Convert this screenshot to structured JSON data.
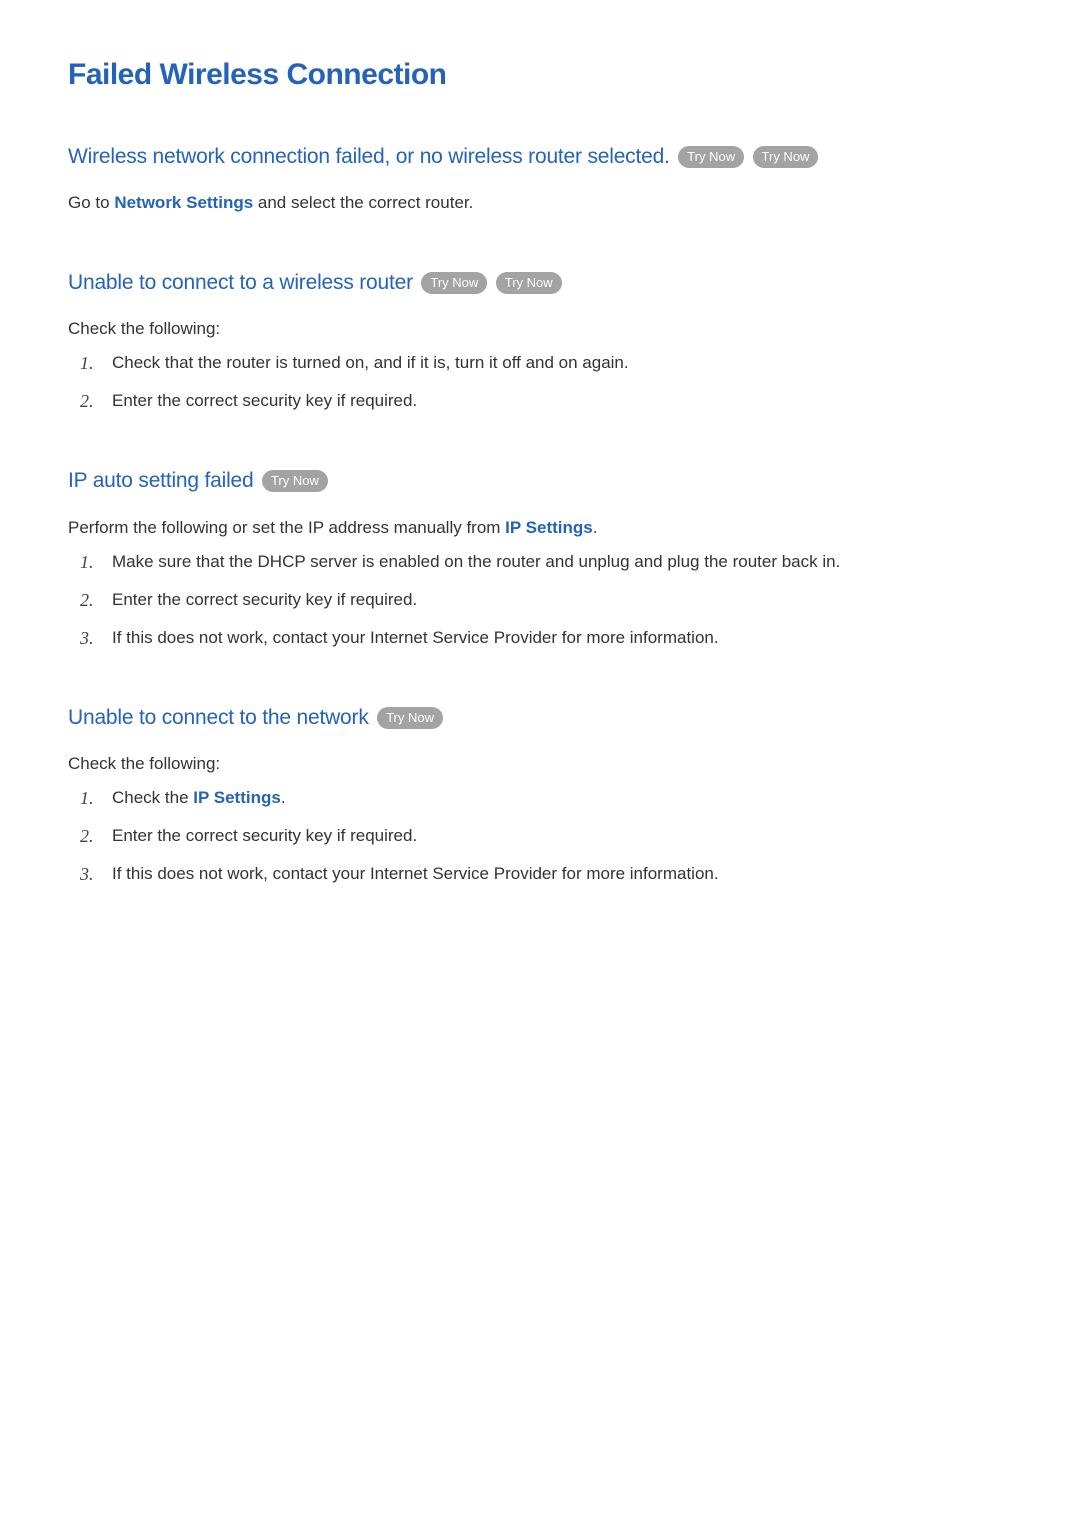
{
  "page_title": "Failed Wireless Connection",
  "try_now_label": "Try Now",
  "sections": {
    "s1": {
      "heading": "Wireless network connection failed, or no wireless router selected.",
      "body_prefix": "Go to ",
      "body_link": "Network Settings",
      "body_suffix": " and select the correct router."
    },
    "s2": {
      "heading": "Unable to connect to a wireless router",
      "intro": "Check the following:",
      "items": {
        "0": "Check that the router is turned on, and if it is, turn it off and on again.",
        "1": "Enter the correct security key if required."
      }
    },
    "s3": {
      "heading": "IP auto setting failed",
      "intro_prefix": "Perform the following or set the IP address manually from ",
      "intro_link": "IP Settings",
      "intro_suffix": ".",
      "items": {
        "0": "Make sure that the DHCP server is enabled on the router and unplug and plug the router back in.",
        "1": "Enter the correct security key if required.",
        "2": "If this does not work, contact your Internet Service Provider for more information."
      }
    },
    "s4": {
      "heading": "Unable to connect to the network",
      "intro": "Check the following:",
      "items": {
        "0_prefix": "Check the ",
        "0_link": "IP Settings",
        "0_suffix": ".",
        "1": "Enter the correct security key if required.",
        "2": "If this does not work, contact your Internet Service Provider for more information."
      }
    }
  }
}
